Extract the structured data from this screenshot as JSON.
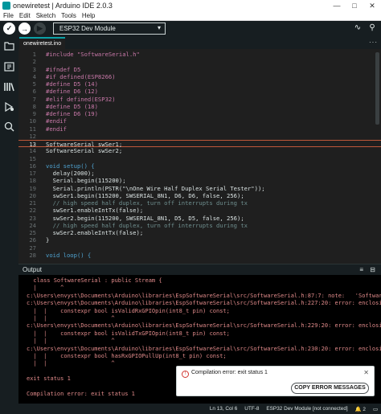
{
  "window": {
    "title": "onewiretest | Arduino IDE 2.0.3",
    "minimize": "—",
    "maximize": "□",
    "close": "✕"
  },
  "menu": [
    "File",
    "Edit",
    "Sketch",
    "Tools",
    "Help"
  ],
  "toolbar": {
    "verify": "✓",
    "upload": "→",
    "debug": "▶",
    "board": "ESP32 Dev Module",
    "board_chevron": "▾",
    "plotter": "∿",
    "serial_monitor": "⚲"
  },
  "tab": {
    "name": "onewiretest.ino",
    "more": "···"
  },
  "editor": {
    "highlighted_line": 13,
    "lines": [
      {
        "n": "1",
        "text": "#include \"SoftwareSerial.h\""
      },
      {
        "n": "2",
        "text": ""
      },
      {
        "n": "3",
        "text": "#ifndef D5"
      },
      {
        "n": "4",
        "text": "#if defined(ESP8266)"
      },
      {
        "n": "5",
        "text": "#define D5 (14)"
      },
      {
        "n": "6",
        "text": "#define D6 (12)"
      },
      {
        "n": "7",
        "text": "#elif defined(ESP32)"
      },
      {
        "n": "8",
        "text": "#define D5 (18)"
      },
      {
        "n": "9",
        "text": "#define D6 (19)"
      },
      {
        "n": "10",
        "text": "#endif"
      },
      {
        "n": "11",
        "text": "#endif"
      },
      {
        "n": "12",
        "text": ""
      },
      {
        "n": "13",
        "text": "SoftwareSerial swSer1;"
      },
      {
        "n": "14",
        "text": "SoftwareSerial swSer2;"
      },
      {
        "n": "15",
        "text": ""
      },
      {
        "n": "16",
        "text": "void setup() {"
      },
      {
        "n": "17",
        "text": "  delay(2000);"
      },
      {
        "n": "18",
        "text": "  Serial.begin(115200);"
      },
      {
        "n": "19",
        "text": "  Serial.println(PSTR(\"\\nOne Wire Half Duplex Serial Tester\"));"
      },
      {
        "n": "20",
        "text": "  swSer1.begin(115200, SWSERIAL_8N1, D6, D6, false, 256);"
      },
      {
        "n": "21",
        "text": "  // high speed half duplex, turn off interrupts during tx"
      },
      {
        "n": "22",
        "text": "  swSer1.enableIntTx(false);"
      },
      {
        "n": "23",
        "text": "  swSer2.begin(115200, SWSERIAL_8N1, D5, D5, false, 256);"
      },
      {
        "n": "24",
        "text": "  // high speed half duplex, turn off interrupts during tx"
      },
      {
        "n": "25",
        "text": "  swSer2.enableIntTx(false);"
      },
      {
        "n": "26",
        "text": "}"
      },
      {
        "n": "27",
        "text": ""
      },
      {
        "n": "28",
        "text": "void loop() {"
      }
    ]
  },
  "output": {
    "title": "Output",
    "header_icons": "≡ ⊟",
    "lines": [
      "  class SoftwareSerial : public Stream {",
      "  |       ^",
      "c:\\Users\\envyst\\Documents\\Arduino\\libraries\\EspSoftwareSerial\\src/SoftwareSerial.h:87:7: note:   'SoftwareSerial' h",
      "c:\\Users\\envyst\\Documents\\Arduino\\libraries\\EspSoftwareSerial\\src/SoftwareSerial.h:227:20: error: enclosing class o",
      "  |  |    constexpr bool isValidRxGPIOpin(int8_t pin) const;",
      "  |  |                   ^",
      "c:\\Users\\envyst\\Documents\\Arduino\\libraries\\EspSoftwareSerial\\src/SoftwareSerial.h:229:20: error: enclosing class o",
      "  |  |    constexpr bool isValidTxGPIOpin(int8_t pin) const;",
      "  |  |                   ^",
      "c:\\Users\\envyst\\Documents\\Arduino\\libraries\\EspSoftwareSerial\\src/SoftwareSerial.h:230:20: error: enclosing class o",
      "  |  |    constexpr bool hasRxGPIOPullUp(int8_t pin) const;",
      "  |  |                   ^",
      "",
      "exit status 1",
      "",
      "Compilation error: exit status 1"
    ]
  },
  "notification": {
    "message": "Compilation error: exit status 1",
    "close": "✕",
    "button": "COPY ERROR MESSAGES",
    "icon": "error-icon"
  },
  "status": {
    "position": "Ln 13, Col 6",
    "encoding": "UTF-8",
    "board": "ESP32 Dev Module [not connected]",
    "notifications": "🔔 2",
    "panel": "▭"
  }
}
